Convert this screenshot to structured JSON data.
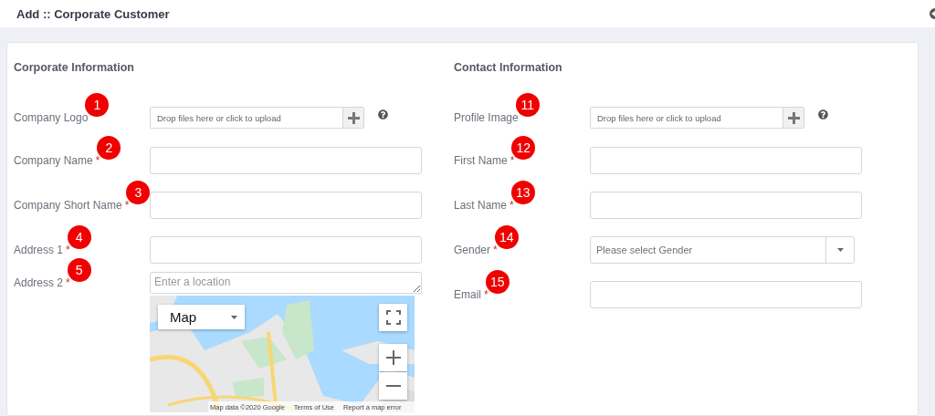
{
  "header": {
    "title": "Add :: Corporate Customer"
  },
  "sections": [
    {
      "heading": "Corporate Information",
      "fields": [
        {
          "kind": "upload",
          "label": "Company Logo",
          "badge": "1",
          "placeholder": "Drop files here or click to upload"
        },
        {
          "kind": "text",
          "label": "Company Name",
          "required_mark": "*",
          "badge": "2"
        },
        {
          "kind": "text",
          "label": "Company Short Name",
          "required_mark": "*",
          "badge": "3"
        },
        {
          "kind": "text",
          "label": "Address 1",
          "required_mark": "*",
          "badge": "4"
        },
        {
          "kind": "location",
          "label": "Address 2",
          "required_mark": "*",
          "badge": "5",
          "placeholder": "Enter a location",
          "map": {
            "type_selector": "Map",
            "attribution": [
              "Map data ©2020 Google",
              "Terms of Use",
              "Report a map error"
            ]
          }
        }
      ]
    },
    {
      "heading": "Contact Information",
      "fields": [
        {
          "kind": "upload",
          "label": "Profile Image",
          "badge": "11",
          "placeholder": "Drop files here or click to upload"
        },
        {
          "kind": "text",
          "label": "First Name",
          "required_mark": "*",
          "badge": "12"
        },
        {
          "kind": "text",
          "label": "Last Name",
          "required_mark": "*",
          "badge": "13"
        },
        {
          "kind": "select",
          "label": "Gender",
          "required_mark": "*",
          "badge": "14",
          "placeholder": "Please select Gender"
        },
        {
          "kind": "text",
          "label": "Email",
          "required_mark": "*",
          "badge": "15"
        }
      ]
    }
  ]
}
